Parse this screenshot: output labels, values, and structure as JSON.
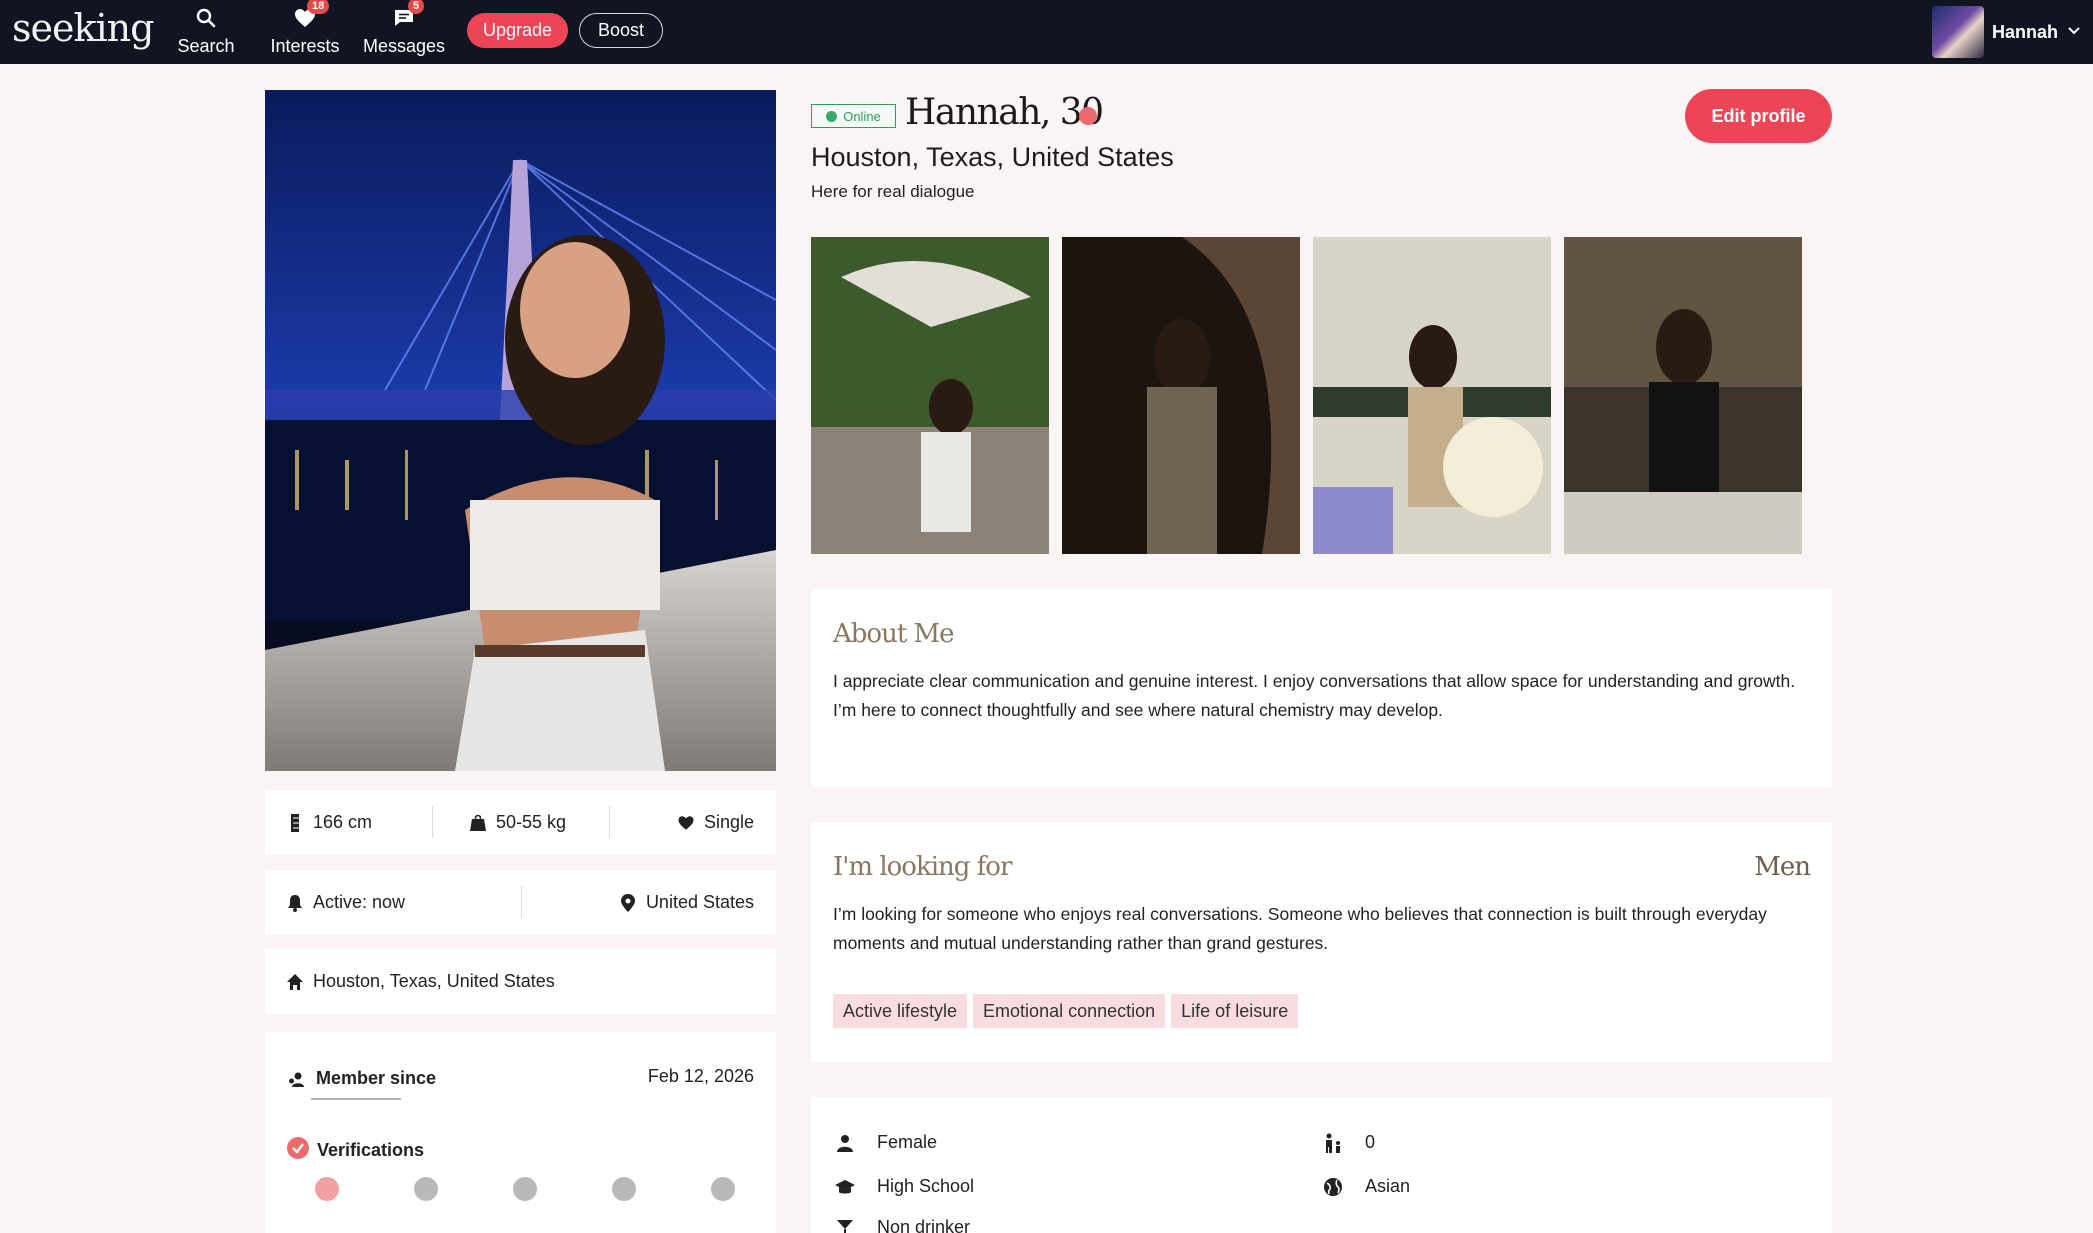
{
  "nav": {
    "logo": "seeking",
    "items": [
      {
        "label": "Search",
        "badge": ""
      },
      {
        "label": "Interests",
        "badge": "18"
      },
      {
        "label": "Messages",
        "badge": "5"
      }
    ],
    "upgrade_label": "Upgrade",
    "boost_label": "Boost",
    "user_name": "Hannah"
  },
  "profile": {
    "status": "Online",
    "name_age": "Hannah, 30",
    "location": "Houston, Texas, United States",
    "tagline": "Here for real dialogue",
    "edit_label": "Edit profile"
  },
  "stats": {
    "height": "166 cm",
    "weight": "50-55 kg",
    "relationship": "Single",
    "active": "Active: now",
    "country": "United States",
    "home": "Houston, Texas, United States",
    "member_since_label": "Member since",
    "member_since_date": "Feb 12, 2026",
    "verifications_label": "Verifications"
  },
  "about": {
    "title": "About Me",
    "body": "I appreciate clear communication and genuine interest. I enjoy conversations that allow space for understanding and growth. I’m here to connect thoughtfully and see where natural chemistry may develop."
  },
  "looking": {
    "title": "I'm looking for",
    "target": "Men",
    "body": "I’m looking for someone who enjoys real conversations. Someone who believes that connection is built through everyday moments and mutual understanding rather than grand gestures.",
    "tags": [
      "Active lifestyle",
      "Emotional connection",
      "Life of leisure"
    ]
  },
  "details": {
    "gender": "Female",
    "children": "0",
    "education": "High School",
    "ethnicity": "Asian",
    "drinking": "Non drinker"
  },
  "colors": {
    "accent": "#ee4556",
    "nav_bg": "#101521",
    "page_bg": "#fbf4f4",
    "online": "#2f9d5c",
    "section_title": "#8a7760",
    "tag_bg": "#f9dcdf"
  }
}
